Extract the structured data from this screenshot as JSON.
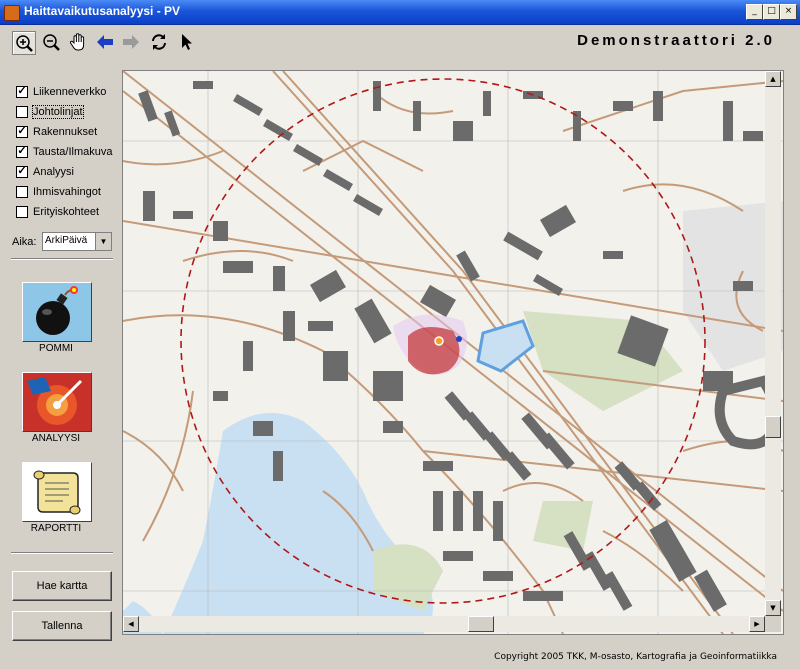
{
  "window": {
    "title": "Haittavaikutusanalyysi - PV",
    "controls": [
      "minimize-icon",
      "maximize-icon",
      "close-icon"
    ]
  },
  "toolbar": {
    "tools": [
      "zoom-in-icon",
      "zoom-out-icon",
      "pan-hand-icon",
      "back-arrow-icon",
      "forward-arrow-icon",
      "refresh-icon",
      "select-pointer-icon"
    ],
    "active_tool": "zoom-in-icon",
    "app_name": "Demonstraattori 2.0"
  },
  "layers": [
    {
      "label": "Liikenneverkko",
      "checked": true
    },
    {
      "label": "Johtolinjat",
      "checked": false
    },
    {
      "label": "Rakennukset",
      "checked": true
    },
    {
      "label": "Tausta/Ilmakuva",
      "checked": true
    },
    {
      "label": "Analyysi",
      "checked": true
    },
    {
      "label": "Ihmisvahingot",
      "checked": false
    },
    {
      "label": "Erityiskohteet",
      "checked": false
    }
  ],
  "time": {
    "label": "Aika:",
    "selected": "ArkiPäivä"
  },
  "actions": [
    {
      "label": "POMMI",
      "icon": "bomb-icon"
    },
    {
      "label": "ANALYYSI",
      "icon": "analysis-icon"
    },
    {
      "label": "RAPORTTI",
      "icon": "report-scroll-icon"
    }
  ],
  "buttons": {
    "fetch_map": "Hae kartta",
    "save": "Tallenna"
  },
  "map": {
    "colors": {
      "background": "#f2f1ec",
      "roads": "#c49a78",
      "buildings": "#6b6b6b",
      "water": "#c9dff2",
      "green": "#c9d8b6",
      "blast_ring": "#b01818",
      "impact": "#c03030"
    }
  },
  "footer": {
    "copyright": "Copyright 2005 TKK, M-osasto, Kartografia ja Geoinformatiikka"
  }
}
